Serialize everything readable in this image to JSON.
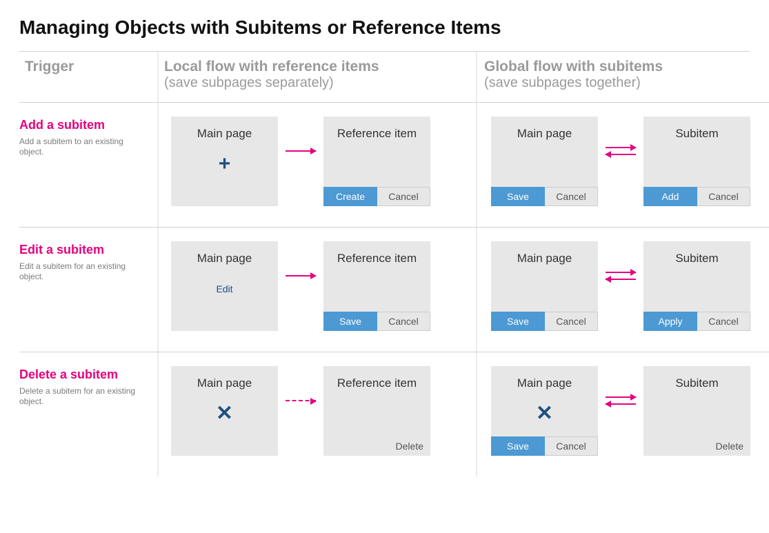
{
  "title": "Managing Objects with Subitems or Reference Items",
  "columns": {
    "trigger": "Trigger",
    "local": {
      "title": "Local flow with reference items",
      "sub": "(save subpages separately)"
    },
    "global": {
      "title": "Global flow with subitems",
      "sub": "(save subpages together)"
    }
  },
  "rows": {
    "add": {
      "trigger_title": "Add a subitem",
      "trigger_desc": "Add a subitem to an existing object.",
      "local": {
        "left_title": "Main page",
        "left_icon": "plus",
        "right_title": "Reference item",
        "right_primary": "Create",
        "right_secondary": "Cancel"
      },
      "global": {
        "left_title": "Main page",
        "left_primary": "Save",
        "left_secondary": "Cancel",
        "right_title": "Subitem",
        "right_primary": "Add",
        "right_secondary": "Cancel"
      }
    },
    "edit": {
      "trigger_title": "Edit a subitem",
      "trigger_desc": "Edit a subitem for an existing object.",
      "local": {
        "left_title": "Main page",
        "left_text": "Edit",
        "right_title": "Reference item",
        "right_primary": "Save",
        "right_secondary": "Cancel"
      },
      "global": {
        "left_title": "Main page",
        "left_primary": "Save",
        "left_secondary": "Cancel",
        "right_title": "Subitem",
        "right_primary": "Apply",
        "right_secondary": "Cancel"
      }
    },
    "delete": {
      "trigger_title": "Delete a subitem",
      "trigger_desc": "Delete a subitem for an existing object.",
      "local": {
        "left_title": "Main page",
        "left_icon": "x",
        "right_title": "Reference item",
        "right_text": "Delete"
      },
      "global": {
        "left_title": "Main page",
        "left_icon": "x",
        "left_primary": "Save",
        "left_secondary": "Cancel",
        "right_title": "Subitem",
        "right_text": "Delete"
      }
    }
  }
}
